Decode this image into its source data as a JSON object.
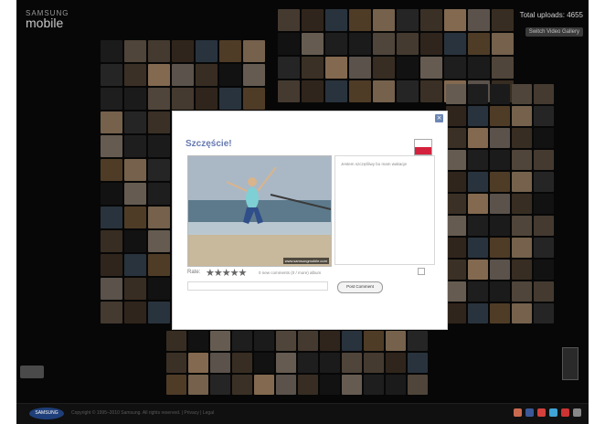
{
  "brand": {
    "line1": "SAMSUNG",
    "line2": "mobile"
  },
  "header": {
    "uploads_label": "Total uploads: 4655",
    "uploads_button": "Switch Video Gallery"
  },
  "modal": {
    "title": "Szczęście!",
    "close_icon": "close-icon",
    "flag_icon": "poland-flag-icon",
    "description": "Jestem szczęśliwy bo mam wakacje",
    "photo_watermark": "www.samsungmobile.com",
    "rate_label": "Rate:",
    "stars_total": 5,
    "stars_text": "★★★★★",
    "comments_info": "0 new comments (0 / more) album",
    "comment_placeholder": "",
    "post_button": "Post Comment"
  },
  "footer": {
    "logo_text": "SAMSUNG",
    "text": "Copyright © 1995–2010 Samsung. All rights reserved. | Privacy | Legal"
  },
  "colors": {
    "title": "#6679b0",
    "background": "#0b0b0b",
    "flag_white": "#ffffff",
    "flag_red": "#d4213d"
  },
  "wall_palette": [
    "#4a3a2c",
    "#7c6a59",
    "#2e2e2e",
    "#1c1c1c",
    "#8a7f73",
    "#5b4a3a",
    "#b49575",
    "#3f4f5f",
    "#6a5a4a",
    "#2a2a2a",
    "#9c8c7c",
    "#574535",
    "#c9a27a",
    "#3a3a3a",
    "#7a5c3c"
  ]
}
